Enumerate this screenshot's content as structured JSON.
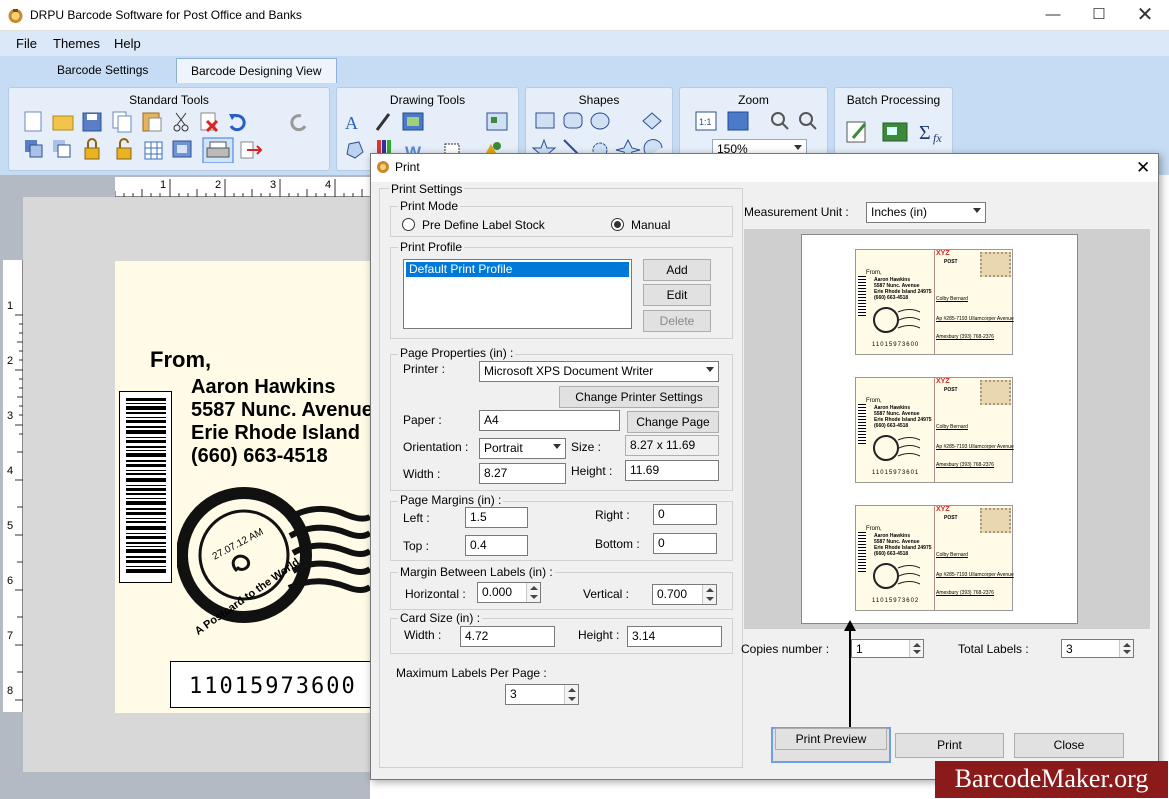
{
  "window": {
    "title": "DRPU Barcode Software for Post Office and Banks"
  },
  "menu": {
    "file": "File",
    "themes": "Themes",
    "help": "Help"
  },
  "tabs": {
    "settings": "Barcode Settings",
    "designing": "Barcode Designing View"
  },
  "ribbon": {
    "standard": "Standard Tools",
    "drawing": "Drawing Tools",
    "shapes": "Shapes",
    "zoom": "Zoom",
    "zoom_value": "150%",
    "batch": "Batch Processing"
  },
  "ruler": {
    "h": [
      "1",
      "2",
      "3",
      "4"
    ],
    "v": [
      "1",
      "2",
      "3",
      "4",
      "5",
      "6",
      "7",
      "8"
    ]
  },
  "label": {
    "from": "From,",
    "name": "Aaron Hawkins",
    "street": "5587 Nunc. Avenue",
    "city": "Erie Rhode Island",
    "phone": "(660) 663-4518",
    "stamp_date": "27.07.12 AM",
    "stamp_text": "A Postcard to the World",
    "barcode_text": "11015973600"
  },
  "dialog": {
    "title": "Print",
    "print_settings": "Print Settings",
    "print_mode": "Print Mode",
    "mode_predefine": "Pre Define Label Stock",
    "mode_manual": "Manual",
    "print_profile": "Print Profile",
    "profile_selected": "Default Print Profile",
    "add": "Add",
    "edit": "Edit",
    "delete": "Delete",
    "page_properties": "Page Properties (in) :",
    "printer_label": "Printer :",
    "printer_value": "Microsoft XPS Document Writer",
    "change_printer": "Change Printer Settings",
    "paper_label": "Paper :",
    "paper_value": "A4",
    "change_page": "Change Page",
    "orientation_label": "Orientation :",
    "orientation_value": "Portrait",
    "size_label": "Size :",
    "size_value": "8.27 x 11.69",
    "width_label": "Width :",
    "width_value": "8.27",
    "height_label": "Height :",
    "height_value": "11.69",
    "page_margins": "Page Margins (in) :",
    "left_label": "Left :",
    "left_value": "1.5",
    "right_label": "Right :",
    "right_value": "0",
    "top_label": "Top :",
    "top_value": "0.4",
    "bottom_label": "Bottom :",
    "bottom_value": "0",
    "margin_between": "Margin Between Labels (in) :",
    "horizontal_label": "Horizontal :",
    "horizontal_value": "0.000",
    "vertical_label": "Vertical :",
    "vertical_value": "0.700",
    "card_size": "Card Size (in) :",
    "card_width_label": "Width :",
    "card_width_value": "4.72",
    "card_height_label": "Height :",
    "card_height_value": "3.14",
    "max_labels_label": "Maximum Labels Per Page :",
    "max_labels_value": "3",
    "measurement_label": "Measurement Unit :",
    "measurement_value": "Inches (in)",
    "copies_label": "Copies number :",
    "copies_value": "1",
    "total_label": "Total Labels :",
    "total_value": "3",
    "preview_button": "Print Preview",
    "print_button": "Print",
    "close_button": "Close"
  },
  "preview_card": {
    "brand": "XYZ",
    "post": "POST",
    "from": "From,",
    "name": "Aaron Hawkins",
    "street": "5587 Nunc. Avenue",
    "city": "Erie Rhode Island 24975",
    "phone": "(660) 663-4518",
    "addr1": "Colby Bernard",
    "addr2": "Ap #285-7193 Ullamcorper Avenue",
    "addr3": "Amesbury (393) 768-2376",
    "codes": [
      "11015973600",
      "11015973601",
      "11015973602"
    ]
  },
  "watermark": "BarcodeMaker.org"
}
